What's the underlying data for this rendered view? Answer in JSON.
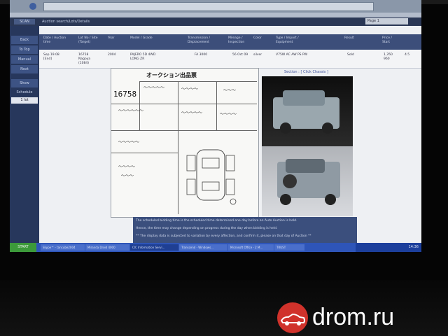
{
  "colors": {
    "brand": "#d0322b",
    "nav": "#2a3755",
    "taskbar": "#2e55b8"
  },
  "nav": {
    "left_label": "SCAN",
    "breadcrumb": "Auction search/Lots/Details",
    "page_label": "Page 1"
  },
  "sidebar": {
    "items": [
      {
        "label": "Back"
      },
      {
        "label": "To Top"
      },
      {
        "label": "Manual"
      },
      {
        "label": "Next"
      },
      {
        "label": "Show"
      },
      {
        "label": "Schedule"
      }
    ],
    "selected": "1 lot"
  },
  "table": {
    "headers": [
      "Date / Auction time",
      "Lot No / Site (Target)",
      "Year",
      "Model / Grade",
      "Transmission / Displacement",
      "Mileage / Inspection",
      "Color",
      "Type / Import / Equipment",
      "Result",
      "Price / Start"
    ],
    "row": {
      "date": "Sep 19.08 [End]",
      "lot": "16758 Nagoya (1084)",
      "year": "2004",
      "model": "PAJERO 5D 4WD LONG ZR",
      "trans": "FA 3000",
      "mileage": "56 Oct 09",
      "color": "silver",
      "type": "V75W AC AW PS PW",
      "result": "Sold",
      "price": "1,760 960",
      "score": "4.5"
    }
  },
  "sheet": {
    "title": "オークション出品票",
    "lot_number": "16758",
    "section_link": "Section : [ Click Chassis ]"
  },
  "notes": {
    "line1": "The scheduled bidding time is the scheduled time determined one day before an Auto Auction is held.",
    "line2": "Hence, the time may change depending on progress during the day when bidding is held.",
    "line3": "** The display data is subjected to variation by every affection, and confirm it, please on that day of Auction **"
  },
  "taskbar": {
    "start": "START",
    "items": [
      {
        "label": "Skype™ - tancube2004"
      },
      {
        "label": "Miranda Droid 4000"
      },
      {
        "label": "CIC Information Servi..."
      },
      {
        "label": "Transcend - Windows..."
      },
      {
        "label": "Microsoft Office - 2 M..."
      },
      {
        "label": "TRUST"
      }
    ],
    "clock": "14:36"
  },
  "watermark": {
    "text": "drom.ru",
    "icon": "car-icon"
  }
}
